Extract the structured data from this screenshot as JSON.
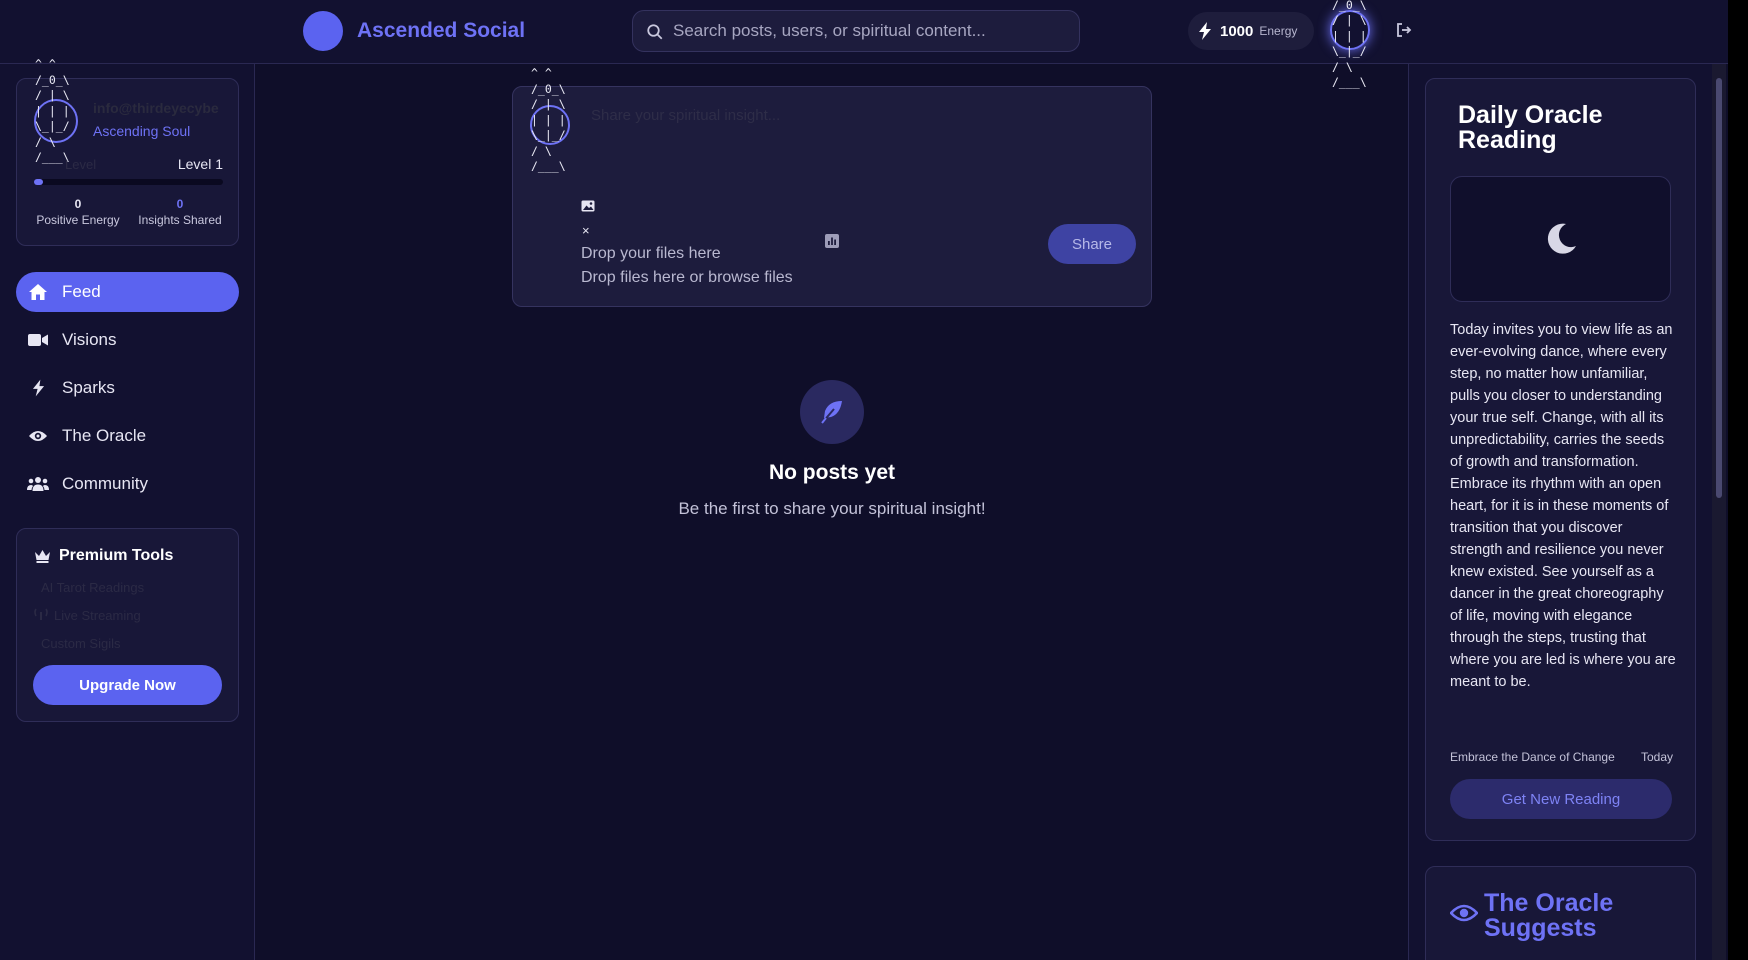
{
  "header": {
    "brand_name": "Ascended Social",
    "search_placeholder": "Search posts, users, or spiritual content...",
    "energy_value": "1000",
    "energy_label": "Energy"
  },
  "ascii_avatar": "^ ^\n/_0_\\\n/ | \\\n| | |\n\\_|_/\n/ \\\n/___\\",
  "profile": {
    "email": "info@thirdeyecybe",
    "rank": "Ascending Soul",
    "level_label": "Level",
    "level_value": "Level 1",
    "level_progress": 0.05,
    "positive_energy": "0",
    "positive_energy_label": "Positive Energy",
    "insights_shared": "0",
    "insights_shared_label": "Insights Shared"
  },
  "nav": {
    "items": [
      {
        "label": "Feed",
        "icon": "home-icon",
        "active": true
      },
      {
        "label": "Visions",
        "icon": "video-icon",
        "active": false
      },
      {
        "label": "Sparks",
        "icon": "bolt-icon",
        "active": false
      },
      {
        "label": "The Oracle",
        "icon": "eye-icon",
        "active": false
      },
      {
        "label": "Community",
        "icon": "users-icon",
        "active": false
      }
    ]
  },
  "premium": {
    "title": "Premium Tools",
    "items": [
      "AI Tarot Readings",
      "Live Streaming",
      "Custom Sigils"
    ],
    "upgrade_label": "Upgrade Now"
  },
  "composer": {
    "placeholder": "Share your spiritual insight...",
    "close_label": "×",
    "drop_title": "Drop your files here",
    "drop_sub": "Drop files here or browse files",
    "share_label": "Share"
  },
  "feed": {
    "empty_title": "No posts yet",
    "empty_sub": "Be the first to share your spiritual insight!"
  },
  "oracle": {
    "title": "Daily Oracle Reading",
    "reading": "Today invites you to view life as an ever-evolving dance, where every step, no matter how unfamiliar, pulls you closer to understanding your true self. Change, with all its unpredictability, carries the seeds of growth and transformation. Embrace its rhythm with an open heart, for it is in these moments of transition that you discover strength and resilience you never knew existed. See yourself as a dancer in the great choreography of life, moving with elegance through the steps, trusting that where you are led is where you are meant to be.",
    "theme": "Embrace the Dance of Change",
    "date": "Today",
    "button_label": "Get New Reading"
  },
  "suggest": {
    "title": "The Oracle Suggests"
  },
  "colors": {
    "accent": "#5b63f0",
    "background": "#0f0e29",
    "panel": "#181738"
  }
}
